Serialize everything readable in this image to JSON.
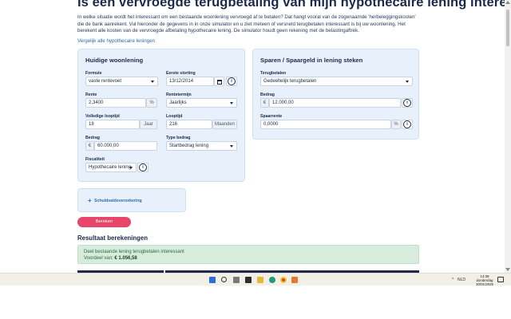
{
  "page": {
    "title": "Is een vervroegde terugbetaling van mijn hypothecaire lening interessant?",
    "intro": "In welke situatie wordt het interessant om een bestaande woonlening vervroegd af te betalen? Dat hangt vooral van de zogenaamde 'herbeleggingskosten' die de bank aanrekent. Vul hieronder de gegevens in in onze simulator en u ziet meteen of versneld terugbetalen interessant is bij uw woonlening. Het berekent alle kosten van de vervroegde afbetaling hypothecaire lening. De simulator houdt geen rekening met de belastingaftrek.",
    "compare_link": "Vergelijk alle hypothecaire leningen"
  },
  "left_card": {
    "title": "Huidige woonlening",
    "formule": {
      "label": "Formule",
      "value": "vaste rentevoet"
    },
    "eerste_storting": {
      "label": "Eerste storting",
      "value": "13/12/2014"
    },
    "rente": {
      "label": "Rente",
      "value": "2,3400",
      "unit": "%"
    },
    "rentetermijn": {
      "label": "Rentetermijn",
      "value": "Jaarlijks"
    },
    "looptijd_volledig": {
      "label": "Volledige looptijd",
      "value": "18",
      "unit": "Jaar"
    },
    "looptijd": {
      "label": "Looptijd",
      "value": "216",
      "unit": "Maanden"
    },
    "bedrag": {
      "label": "Bedrag",
      "currency": "€",
      "value": "60.000,00"
    },
    "type_bedrag": {
      "label": "Type bedrag",
      "value": "Startbedrag lening"
    },
    "fiscaliteit": {
      "label": "Fiscaliteit",
      "value": "Hypothecaire lening"
    }
  },
  "right_card": {
    "title": "Sparen / Spaargeld in lening steken",
    "terugbetalen": {
      "label": "Terugbetalen",
      "value": "Gedeeltelijk terugbetalen"
    },
    "bedrag": {
      "label": "Bedrag",
      "currency": "€",
      "value": "12.000,00"
    },
    "spaarrente": {
      "label": "Spaarrente",
      "value": "0,0000",
      "unit": "%"
    }
  },
  "extra": {
    "label": "Schuldsaldoverzekering",
    "plus": "+"
  },
  "calc_button": "Bereken",
  "results": {
    "title": "Resultaat berekeningen",
    "line1": "Deel bestaande lening terugbetalen interessant",
    "line2_prefix": "Voordeel van:",
    "line2_value": "€ 1.056,58"
  },
  "taskbar": {
    "time": "14:39",
    "day": "donderdag",
    "date": "30/01/2025",
    "lang": "NLD"
  },
  "colors": {
    "accent": "#e8456b",
    "card_bg": "#e8f1fb",
    "result_bg": "#d7ecdd",
    "heading": "#1b2a4a",
    "link": "#2b6cb0"
  }
}
